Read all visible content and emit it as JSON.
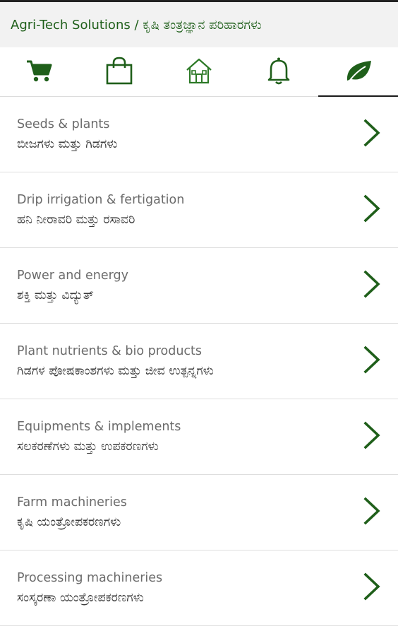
{
  "header": {
    "title": "Agri-Tech Solutions / ಕೃಷಿ ತಂತ್ರಜ್ಞಾನ ಪರಿಹಾರಗಳು"
  },
  "tabs": [
    {
      "icon": "cart-icon",
      "active": false
    },
    {
      "icon": "shopping-bag-icon",
      "active": false
    },
    {
      "icon": "home-icon",
      "active": false
    },
    {
      "icon": "bell-icon",
      "active": false
    },
    {
      "icon": "leaf-icon",
      "active": true
    }
  ],
  "categories": [
    {
      "en": "Seeds & plants",
      "kn": "ಬೀಜಗಳು ಮತ್ತು ಗಿಡಗಳು"
    },
    {
      "en": "Drip irrigation & fertigation",
      "kn": "ಹನಿ ನೀರಾವರಿ ಮತ್ತು ರಸಾವರಿ"
    },
    {
      "en": "Power and energy",
      "kn": "ಶಕ್ತಿ ಮತ್ತು ವಿದ್ಯುತ್"
    },
    {
      "en": "Plant nutrients & bio products",
      "kn": "ಗಿಡಗಳ ಪೋಷಕಾಂಶಗಳು ಮತ್ತು ಜೀವ ಉತ್ಪನ್ನಗಳು"
    },
    {
      "en": "Equipments & implements",
      "kn": "ಸಲಕರಣೆಗಳು ಮತ್ತು ಉಪಕರಣಗಳು"
    },
    {
      "en": "Farm machineries",
      "kn": "ಕೃಷಿ ಯಂತ್ರೋಪಕರಣಗಳು"
    },
    {
      "en": "Processing machineries",
      "kn": "ಸಂಸ್ಕರಣಾ ಯಂತ್ರೋಪಕರಣಗಳು"
    }
  ],
  "colors": {
    "brand_green": "#1f5f1a",
    "header_bg": "#f2f2f2",
    "divider": "#dedede"
  }
}
